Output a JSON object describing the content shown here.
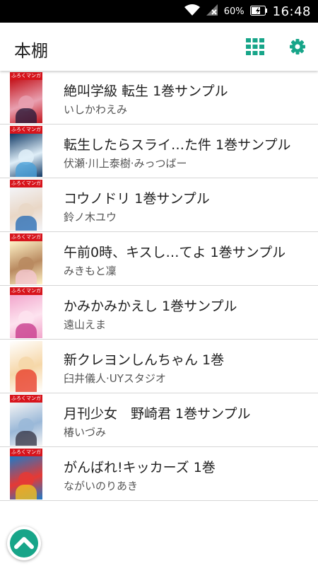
{
  "status_bar": {
    "battery_percent": "60%",
    "time": "16:48"
  },
  "app_bar": {
    "title": "本棚",
    "accent_color": "#17a589"
  },
  "cover_band_text": "ふろくマンガ",
  "books": [
    {
      "title": "絶叫学級 転生 1巻サンプル",
      "author": "いしかわえみ",
      "cover_colors": [
        "#c4151d",
        "#2a1a3a",
        "#e8a0b0"
      ],
      "band": true
    },
    {
      "title": "転生したらスライ…た件 1巻サンプル",
      "author": "伏瀬·川上泰樹·みっつばー",
      "cover_colors": [
        "#123a66",
        "#4aa0d8",
        "#dfeef8"
      ],
      "band": true
    },
    {
      "title": "コウノドリ 1巻サンプル",
      "author": "鈴ノ木ユウ",
      "cover_colors": [
        "#f3f4f8",
        "#2c6fb6",
        "#e9d7c6"
      ],
      "band": true
    },
    {
      "title": "午前0時、キスし…てよ 1巻サンプル",
      "author": "みきもと凜",
      "cover_colors": [
        "#fff3c8",
        "#f5c8d2",
        "#b98a60"
      ],
      "band": true
    },
    {
      "title": "かみかみかえし 1巻サンプル",
      "author": "遠山えま",
      "cover_colors": [
        "#f2a6cc",
        "#c93e8e",
        "#fde3ef"
      ],
      "band": true
    },
    {
      "title": "新クレヨンしんちゃん 1巻",
      "author": "臼井儀人·UYスタジオ",
      "cover_colors": [
        "#ffffff",
        "#e8402c",
        "#f6d7a8"
      ],
      "band": false
    },
    {
      "title": "月刊少女　野崎君 1巻サンプル",
      "author": "椿いづみ",
      "cover_colors": [
        "#f4f4f4",
        "#3a3a4a",
        "#9ab8d8"
      ],
      "band": true
    },
    {
      "title": "がんばれ!キッカーズ 1巻",
      "author": "ながいのりあき",
      "cover_colors": [
        "#1d7ac8",
        "#f0c020",
        "#e53935"
      ],
      "band": true
    }
  ]
}
